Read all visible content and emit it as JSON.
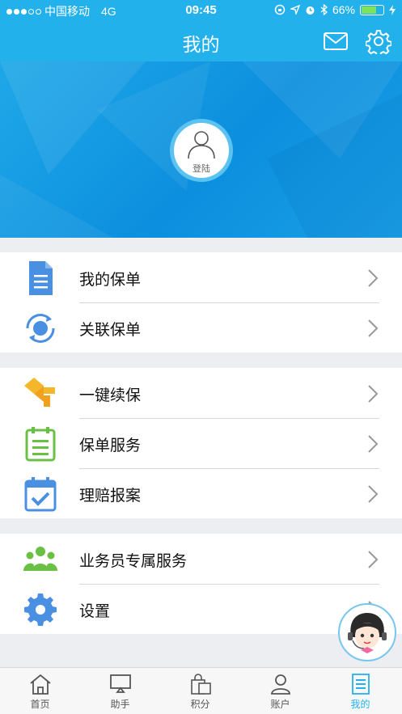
{
  "status": {
    "carrier": "中国移动",
    "network": "4G",
    "time": "09:45",
    "battery": "66%"
  },
  "header": {
    "title": "我的"
  },
  "profile": {
    "login_label": "登陆"
  },
  "groups": [
    {
      "items": [
        {
          "label": "我的保单",
          "icon": "document-icon"
        },
        {
          "label": "关联保单",
          "icon": "link-sync-icon"
        }
      ]
    },
    {
      "items": [
        {
          "label": "一键续保",
          "icon": "renew-icon"
        },
        {
          "label": "保单服务",
          "icon": "clipboard-icon"
        },
        {
          "label": "理赔报案",
          "icon": "calendar-check-icon"
        }
      ]
    },
    {
      "items": [
        {
          "label": "业务员专属服务",
          "icon": "agents-icon"
        },
        {
          "label": "设置",
          "icon": "gear-icon"
        }
      ]
    }
  ],
  "tabs": [
    {
      "label": "首页",
      "icon": "home-icon"
    },
    {
      "label": "助手",
      "icon": "assistant-icon"
    },
    {
      "label": "积分",
      "icon": "points-bag-icon"
    },
    {
      "label": "账户",
      "icon": "person-icon"
    },
    {
      "label": "我的",
      "icon": "mine-icon",
      "active": true
    }
  ],
  "colors": {
    "primary": "#23b1ec",
    "hero": "#0c8fde",
    "background": "#eceef2"
  }
}
